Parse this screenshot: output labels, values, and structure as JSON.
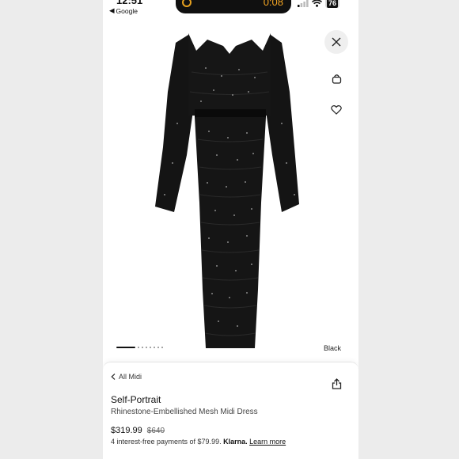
{
  "status_bar": {
    "time": "12:51",
    "back_app": "Google",
    "timer": "0:08",
    "battery": "76"
  },
  "gallery": {
    "color_name": "Black",
    "image_count": 8,
    "active_index": 0
  },
  "product": {
    "breadcrumb": "All Midi",
    "brand": "Self-Portrait",
    "name": "Rhinestone-Embellished Mesh Midi Dress",
    "price_sale": "$319.99",
    "price_original": "$640",
    "installments_text": "4 interest-free payments of $79.99.",
    "klarna": "Klarna.",
    "learn_more": "Learn more"
  },
  "icons": {
    "close": "close-icon",
    "bag": "shopping-bag-icon",
    "wishlist": "heart-icon",
    "share": "share-icon",
    "back": "chevron-left-icon"
  },
  "colors": {
    "timer_accent": "#f5a623",
    "dress": "#111111"
  }
}
